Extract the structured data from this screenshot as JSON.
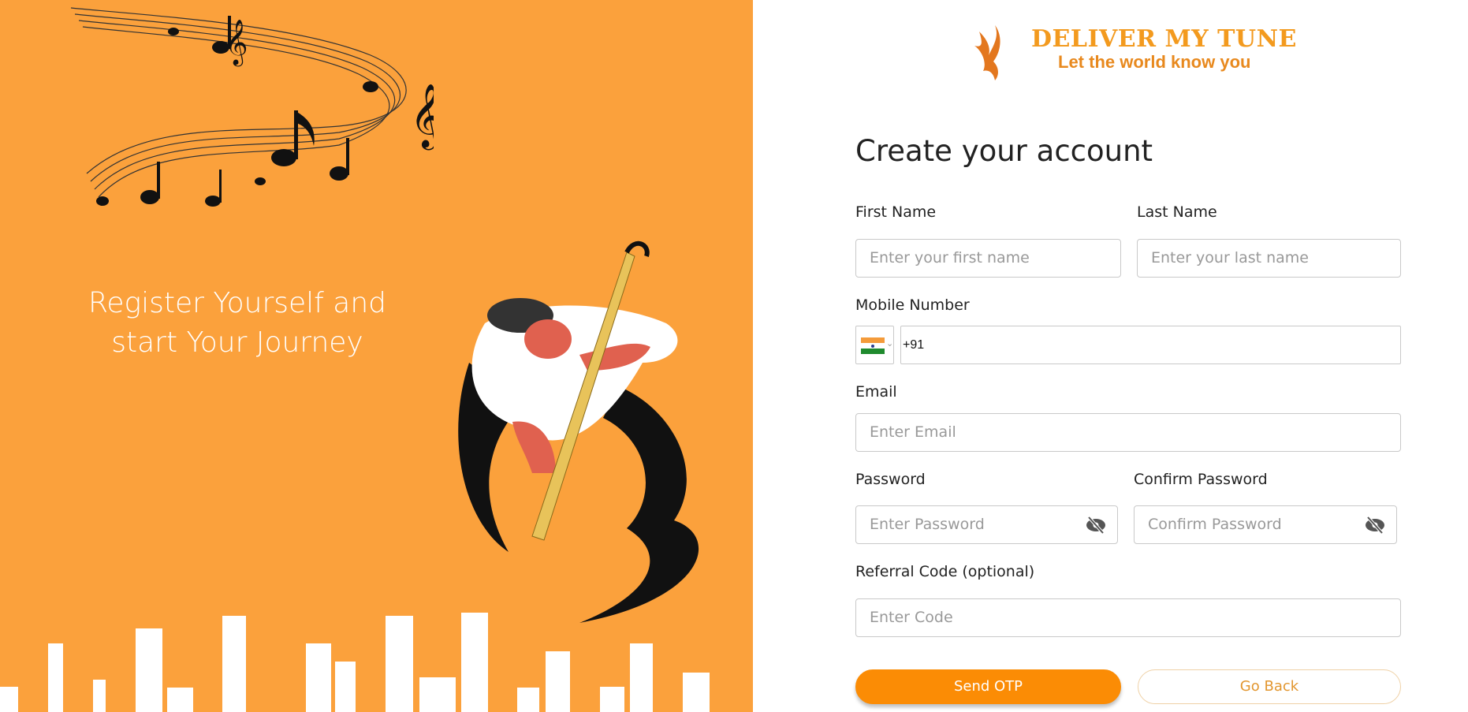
{
  "left_panel": {
    "background": "#FBA13C",
    "tagline_line1": "Register Yourself and",
    "tagline_line2": "start Your Journey"
  },
  "logo": {
    "title": "DELIVER MY TUNE",
    "subtitle": "Let the world know you",
    "icon": "phoenix-icon"
  },
  "form": {
    "title": "Create your account",
    "first_name": {
      "label": "First Name",
      "placeholder": "Enter your first name"
    },
    "last_name": {
      "label": "Last Name",
      "placeholder": "Enter your last name"
    },
    "mobile": {
      "label": "Mobile Number",
      "country_flag": "india-flag-icon",
      "value": "+91"
    },
    "email": {
      "label": "Email",
      "placeholder": "Enter Email"
    },
    "password": {
      "label": "Password",
      "placeholder": "Enter Password",
      "icon": "eye-slash-icon"
    },
    "confirm_password": {
      "label": "Confirm Password",
      "placeholder": "Confirm Password",
      "icon": "eye-slash-icon"
    },
    "referral": {
      "label": "Referral Code (optional)",
      "placeholder": "Enter Code"
    },
    "send_otp_label": "Send OTP",
    "go_back_label": "Go Back"
  },
  "colors": {
    "accent": "#FB8C05",
    "panel": "#FBA13C"
  }
}
